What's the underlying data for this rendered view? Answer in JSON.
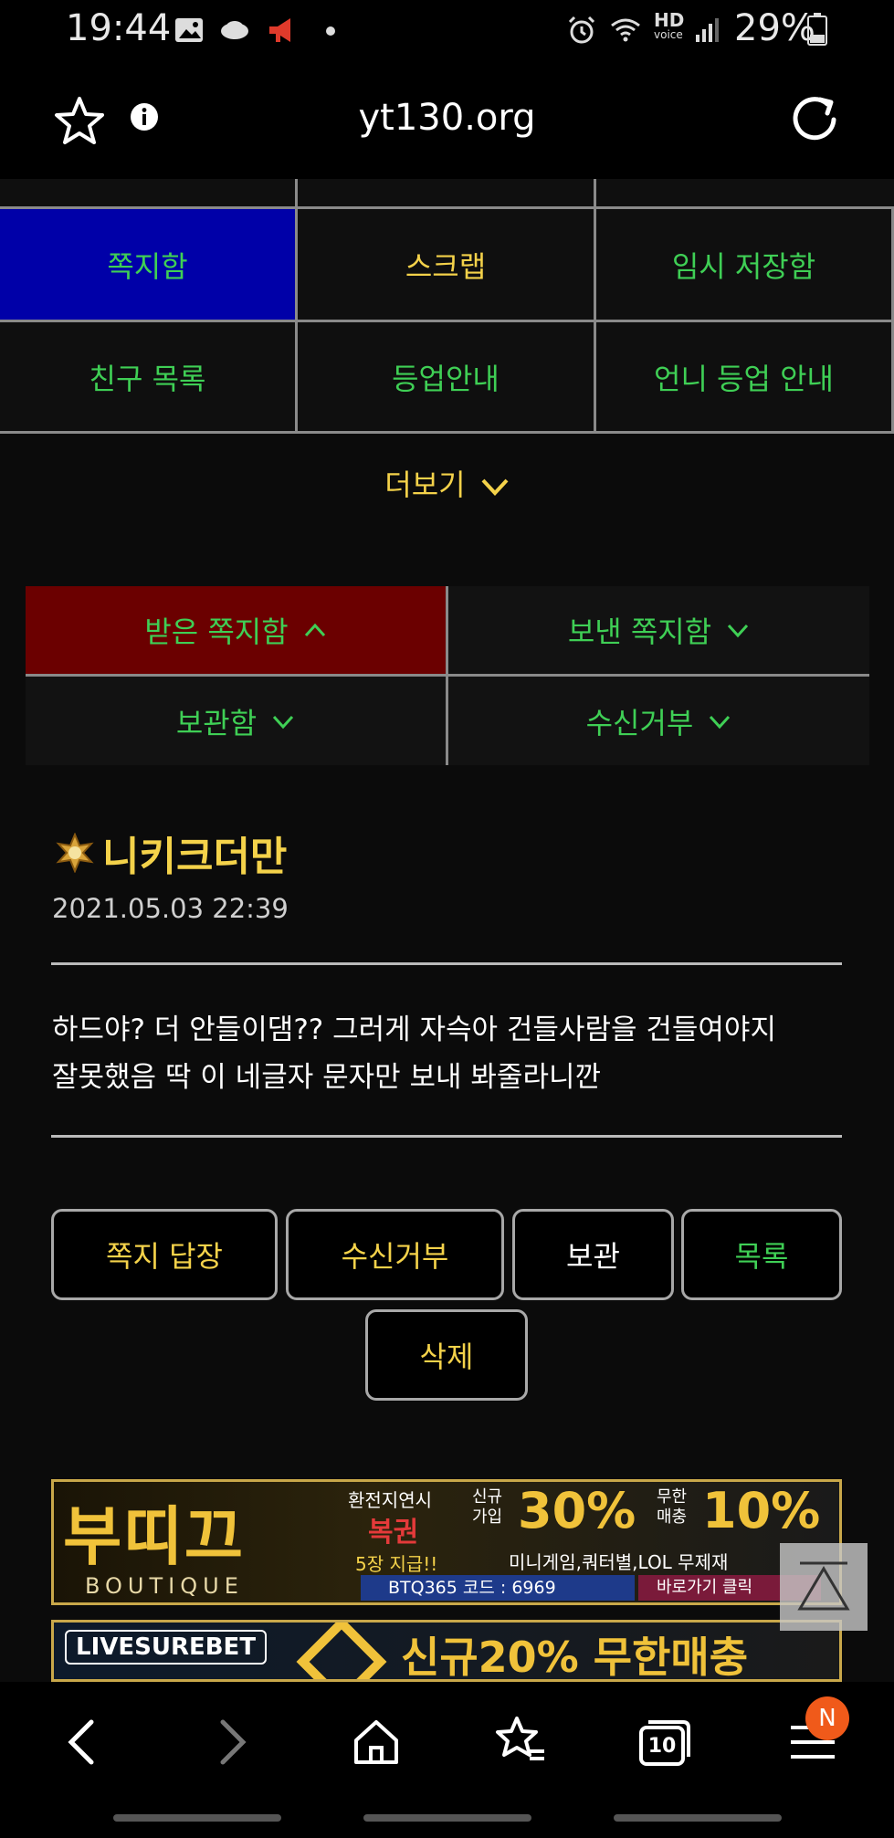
{
  "status_bar": {
    "time": "19:44",
    "battery": "29%",
    "hd_label": "HD",
    "voice_label": "voice"
  },
  "browser": {
    "url": "yt130.org"
  },
  "menu_grid": {
    "rows": [
      [
        "쪽지함",
        "스크랩",
        "임시 저장함"
      ],
      [
        "친구 목록",
        "등업안내",
        "언니 등업 안내"
      ]
    ],
    "more_label": "더보기"
  },
  "message_tabs": [
    {
      "label": "받은 쪽지함",
      "active": true
    },
    {
      "label": "보낸 쪽지함",
      "active": false
    },
    {
      "label": "보관함",
      "active": false
    },
    {
      "label": "수신거부",
      "active": false
    }
  ],
  "message": {
    "sender": "니키크더만",
    "date": "2021.05.03 22:39",
    "body_line1": "하드야? 더 안들이댐?? 그러게 자슥아 건들사람을 건들여야지",
    "body_line2": "잘못했음 딱 이 네글자 문자만 보내 봐줄라니깐"
  },
  "actions": {
    "reply": "쪽지 답장",
    "block": "수신거부",
    "archive": "보관",
    "list": "목록",
    "delete": "삭제"
  },
  "ads": {
    "ad1": {
      "brand": "부띠끄",
      "brand_sub": "BOUTIQUE",
      "line1a": "환전지연시",
      "line1b": "복권",
      "line1c": "5장 지급!!",
      "promo_a_label": "신규 가입",
      "promo_a": "30%",
      "promo_b_label": "무한 매충",
      "promo_b": "10%",
      "games": "미니게임,쿼터별,LOL 무제재",
      "code": "BTQ365 코드 : 6969",
      "shortcut": "바로가기 클릭"
    },
    "ad2": {
      "brand": "LIVESUREBET",
      "promo": "신규20% 무한매충10%"
    }
  },
  "nav": {
    "tabs_count": "10",
    "badge": "N"
  },
  "colors": {
    "active_menu": "#0000a8",
    "active_tab": "#6b0000",
    "green_text": "#3fcf55",
    "yellow_text": "#f4d24a"
  }
}
